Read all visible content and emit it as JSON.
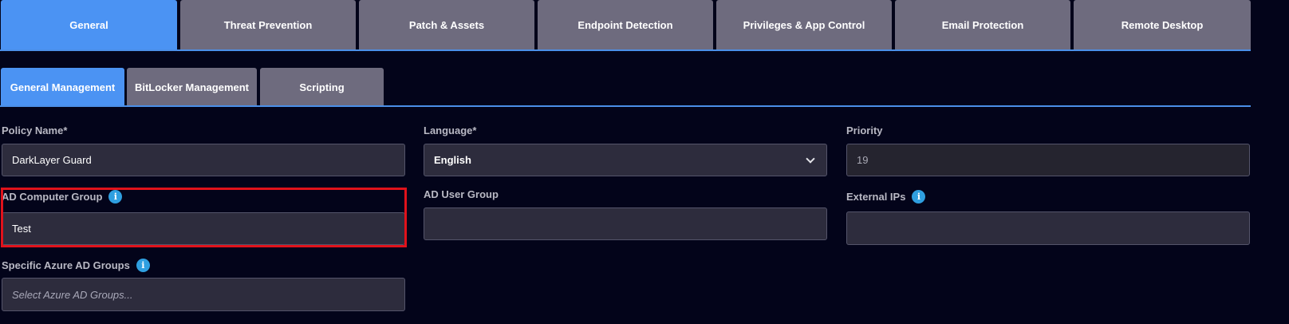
{
  "top_tabs": [
    {
      "label": "General",
      "active": true
    },
    {
      "label": "Threat Prevention",
      "active": false
    },
    {
      "label": "Patch & Assets",
      "active": false
    },
    {
      "label": "Endpoint Detection",
      "active": false
    },
    {
      "label": "Privileges & App Control",
      "active": false
    },
    {
      "label": "Email Protection",
      "active": false
    },
    {
      "label": "Remote Desktop",
      "active": false
    }
  ],
  "sub_tabs": [
    {
      "label": "General Management",
      "active": true
    },
    {
      "label": "BitLocker Management",
      "active": false
    },
    {
      "label": "Scripting",
      "active": false
    }
  ],
  "form": {
    "policy_name": {
      "label": "Policy Name*",
      "value": "DarkLayer Guard"
    },
    "language": {
      "label": "Language*",
      "value": "English"
    },
    "priority": {
      "label": "Priority",
      "value": "19"
    },
    "ad_computer_group": {
      "label": "AD Computer Group",
      "value": "Test"
    },
    "ad_user_group": {
      "label": "AD User Group",
      "value": ""
    },
    "external_ips": {
      "label": "External IPs",
      "value": ""
    },
    "azure_ad_groups": {
      "label": "Specific Azure AD Groups",
      "placeholder": "Select Azure AD Groups..."
    }
  },
  "icons": {
    "info": "info-icon",
    "dropdown": "chevron-down-icon"
  },
  "colors": {
    "accent": "#4b93f3",
    "tab_inactive": "#6e6b7e",
    "background": "#03041a",
    "info_icon": "#2f9fe0",
    "highlight": "#e0121b"
  }
}
